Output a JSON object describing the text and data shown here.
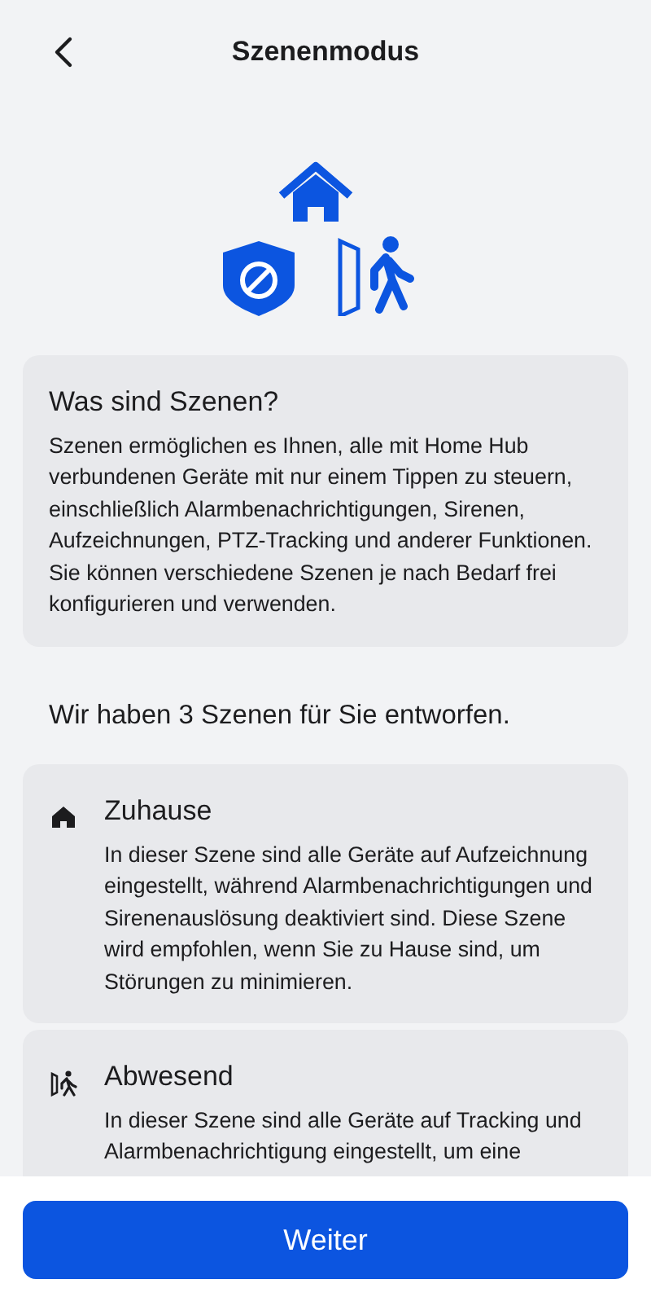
{
  "header": {
    "title": "Szenenmodus"
  },
  "info": {
    "title": "Was sind Szenen?",
    "text": "Szenen ermöglichen es Ihnen, alle mit Home Hub verbundenen Geräte mit nur einem Tippen zu steuern, einschließlich Alarmbenachrichtigungen, Sirenen, Aufzeichnungen, PTZ-Tracking und anderer Funktionen. Sie können verschiedene Szenen je nach Bedarf frei konfigurieren und verwenden."
  },
  "subheading": "Wir haben 3 Szenen für Sie entworfen.",
  "scenes": [
    {
      "kind": "home",
      "title": "Zuhause",
      "text": "In dieser Szene sind alle Geräte auf Aufzeichnung eingestellt, während Alarmbenachrichtigungen und Sirenenauslösung deaktiviert sind. Diese Szene wird empfohlen, wenn Sie zu Hause sind, um Störungen zu minimieren."
    },
    {
      "kind": "away",
      "title": "Abwesend",
      "text": "In dieser Szene sind alle Geräte auf Tracking und Alarmbenachrichtigung eingestellt, um eine"
    }
  ],
  "button": "Weiter"
}
